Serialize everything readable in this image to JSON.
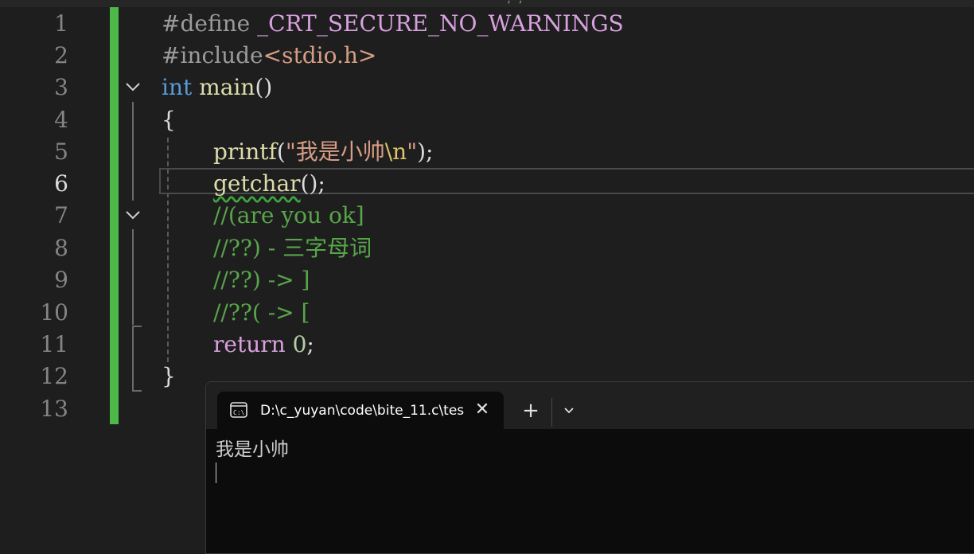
{
  "editor": {
    "line_numbers": [
      "1",
      "2",
      "3",
      "4",
      "5",
      "6",
      "7",
      "8",
      "9",
      "10",
      "11",
      "12",
      "13"
    ],
    "active_line": "6",
    "code": {
      "l1": {
        "directive": "#define",
        "macro": " _CRT_SECURE_NO_WARNINGS"
      },
      "l2": {
        "directive": "#include",
        "header": "<stdio.h>"
      },
      "l3": {
        "type": "int",
        "name": " main",
        "parens": "()"
      },
      "l4": {
        "brace": "{"
      },
      "l5": {
        "fn": "printf",
        "open": "(",
        "str": "\"我是小帅",
        "escape": "\\n",
        "strend": "\"",
        "close": ");"
      },
      "l6": {
        "fn": "getchar",
        "rest": "();"
      },
      "l7": {
        "comment": "//(are you ok]"
      },
      "l8": {
        "comment": "//??) - 三字母词"
      },
      "l9": {
        "comment": "//??) -> ]"
      },
      "l10": {
        "comment": "//??( -> ["
      },
      "l11": {
        "kw": "return",
        "num": " 0",
        "semi": ";"
      },
      "l12": {
        "brace": "}"
      }
    }
  },
  "terminal": {
    "tab_title": "D:\\c_yuyan\\code\\bite_11.c\\tes",
    "close_glyph": "✕",
    "new_tab_glyph": "+",
    "output": "我是小帅"
  }
}
